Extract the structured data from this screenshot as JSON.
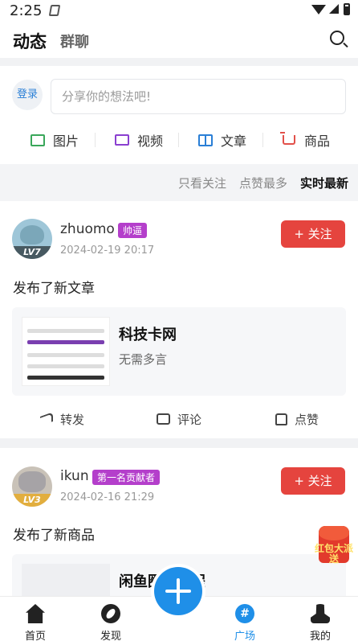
{
  "status_bar": {
    "time": "2:25"
  },
  "header": {
    "tabs": [
      {
        "label": "动态",
        "active": true
      },
      {
        "label": "群聊",
        "active": false
      }
    ],
    "search_icon": "search-icon"
  },
  "composer": {
    "login_label": "登录",
    "placeholder": "分享你的想法吧!",
    "media": [
      {
        "label": "图片",
        "icon": "image-icon",
        "color": "#3aa75a"
      },
      {
        "label": "视频",
        "icon": "video-icon",
        "color": "#8a3fd0"
      },
      {
        "label": "文章",
        "icon": "book-icon",
        "color": "#2a7fd6"
      },
      {
        "label": "商品",
        "icon": "cart-icon",
        "color": "#e2504a"
      }
    ]
  },
  "sort": {
    "options": [
      "只看关注",
      "点赞最多",
      "实时最新"
    ],
    "active": "实时最新"
  },
  "posts": [
    {
      "username": "zhuomo",
      "badge": "帅逼",
      "level": "LV7",
      "time": "2024-02-19 20:17",
      "follow_label": "+ 关注",
      "text": "发布了新文章",
      "card_title": "科技卡网",
      "card_desc": "无需多言",
      "actions": [
        "转发",
        "评论",
        "点赞"
      ]
    },
    {
      "username": "ikun",
      "badge": "第一名贡献者",
      "level": "LV3",
      "time": "2024-02-16 21:29",
      "follow_label": "+ 关注",
      "text": "发布了新商品",
      "card_title": "闲鱼圈号教程",
      "card_desc": ""
    }
  ],
  "floating_badge": {
    "text": "红包大派送"
  },
  "tab_bar": {
    "items": [
      {
        "label": "首页",
        "icon": "home-icon",
        "active": false
      },
      {
        "label": "发现",
        "icon": "compass-icon",
        "active": false
      },
      {
        "label": "广场",
        "icon": "hash-icon",
        "active": true
      },
      {
        "label": "我的",
        "icon": "user-icon",
        "active": false
      }
    ],
    "center_icon": "plus-icon"
  },
  "colors": {
    "accent": "#1f8fe8",
    "follow": "#e5443e",
    "badge": "#b43fcb"
  }
}
